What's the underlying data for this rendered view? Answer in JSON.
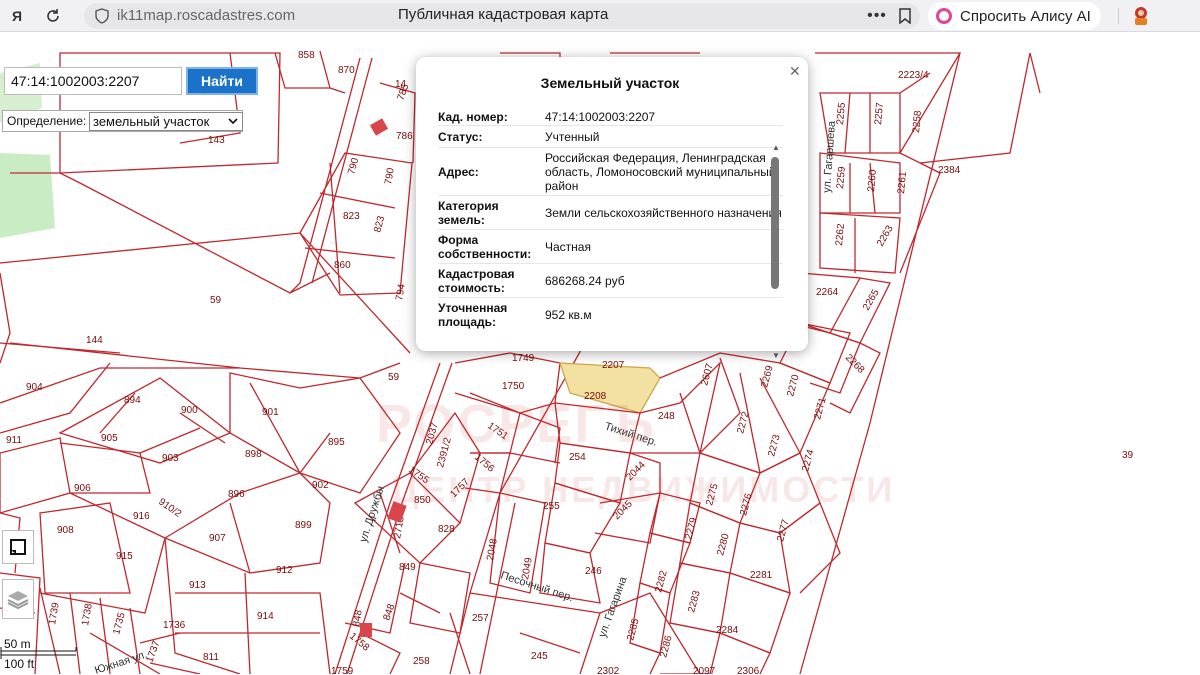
{
  "browser": {
    "logo": "Я",
    "url": "ik11map.roscadastres.com",
    "title": "Публичная кадастровая карта",
    "alice_label": "Спросить Алису AI"
  },
  "search": {
    "value": "47:14:1002003:2207",
    "button_label": "Найти",
    "definition_label": "Определение:",
    "definition_value": "земельный участок"
  },
  "scale": {
    "metric": "50 m",
    "imperial": "100 ft"
  },
  "popup": {
    "title": "Земельный участок",
    "rows": [
      {
        "key": "Кад. номер:",
        "value": "47:14:1002003:2207"
      },
      {
        "key": "Статус:",
        "value": "Учтенный"
      },
      {
        "key": "Адрес:",
        "value": "Российская Федерация, Ленинградская область, Ломоносовский муниципальный район"
      },
      {
        "key": "Категория земель:",
        "value": "Земли сельскохозяйственного назначения"
      },
      {
        "key": "Форма собственности:",
        "value": "Частная"
      },
      {
        "key": "Кадастровая стоимость:",
        "value": "686268.24 руб"
      },
      {
        "key": "Уточненная площадь:",
        "value": "952 кв.м"
      }
    ]
  },
  "watermark": {
    "main": "РОСРЕГЪ",
    "sub": "ЦЕНТР НЕДВИЖИМОСТИ"
  },
  "map": {
    "selected_parcel": "2207",
    "parcel_labels": [
      "858",
      "870",
      "14",
      "785",
      "786",
      "143",
      "790",
      "790",
      "823",
      "823",
      "860",
      "794",
      "59",
      "144",
      "59",
      "904",
      "894",
      "900",
      "901",
      "895",
      "911",
      "905",
      "903",
      "898",
      "902",
      "906",
      "910/2",
      "896",
      "916",
      "908",
      "907",
      "899",
      "915",
      "913",
      "912",
      "914",
      "1739",
      "1738",
      "1735",
      "1736",
      "1737",
      "811",
      "1759",
      "848",
      "848",
      "1758",
      "2037",
      "2391/2",
      "1755",
      "1756",
      "1757",
      "850",
      "2713",
      "828",
      "849",
      "2048",
      "2049",
      "246",
      "257",
      "258",
      "245",
      "255",
      "254",
      "2044",
      "2045",
      "248",
      "2208",
      "1750",
      "1751",
      "1749",
      "2207",
      "2607",
      "2269",
      "2270",
      "2271",
      "2272",
      "2273",
      "2274",
      "2275",
      "2276",
      "2277",
      "2279",
      "2280",
      "2281",
      "2282",
      "2283",
      "2284",
      "2285",
      "2286",
      "2255",
      "2257",
      "2258",
      "2259",
      "2260",
      "2261",
      "2262",
      "2263",
      "2264",
      "2265",
      "2268",
      "2223/4",
      "2384",
      "39",
      "2097",
      "2302",
      "2306"
    ],
    "streets": [
      "ул. Дружбы",
      "Тихий пер.",
      "Песочный пер.",
      "ул. Гагарина",
      "ул. Гагаршева",
      "Южная ул."
    ]
  }
}
